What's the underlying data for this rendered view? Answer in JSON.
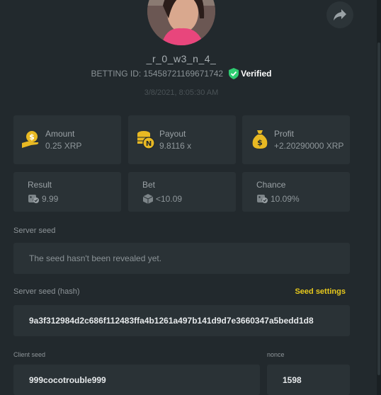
{
  "profile": {
    "username": "_r_0_w3_n_4_",
    "betting_id": "BETTING ID: 15458721169671742",
    "verified_label": "Verified",
    "timestamp": "3/8/2021, 8:05:30 AM"
  },
  "stats": {
    "amount": {
      "label": "Amount",
      "value": "0.25 XRP"
    },
    "payout": {
      "label": "Payout",
      "value": "9.8116 x"
    },
    "profit": {
      "label": "Profit",
      "value": "+2.20290000 XRP"
    },
    "result": {
      "label": "Result",
      "value": "9.99"
    },
    "bet": {
      "label": "Bet",
      "value": "<10.09"
    },
    "chance": {
      "label": "Chance",
      "value": "10.09%"
    }
  },
  "server_seed": {
    "label": "Server seed",
    "value": "The seed hasn't been revealed yet."
  },
  "server_seed_hash": {
    "label": "Server seed (hash)",
    "settings_link": "Seed settings",
    "value": "9a3f312984d2c686f112483ffa4b1261a497b141d9d7e3660347a5bedd1d8"
  },
  "client_seed": {
    "label": "Client seed",
    "value": "999cocotrouble999"
  },
  "nonce": {
    "label": "nonce",
    "value": "1598"
  },
  "colors": {
    "accent": "#e8c91c",
    "verified": "#2ecc71",
    "coin": "#e8b923"
  }
}
